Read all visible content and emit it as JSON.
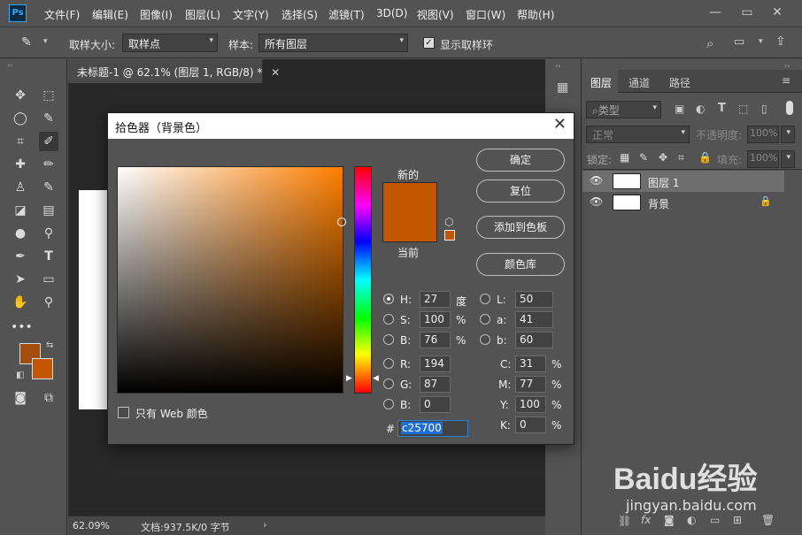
{
  "app": {
    "logo": "Ps"
  },
  "menu": [
    "文件(F)",
    "编辑(E)",
    "图像(I)",
    "图层(L)",
    "文字(Y)",
    "选择(S)",
    "滤镜(T)",
    "3D(D)",
    "视图(V)",
    "窗口(W)",
    "帮助(H)"
  ],
  "options": {
    "sample_size_label": "取样大小:",
    "sample_size_value": "取样点",
    "sample_label": "样本:",
    "sample_value": "所有图层",
    "show_ring_label": "显示取样环",
    "show_ring_checked": true
  },
  "document": {
    "tab_title": "未标题-1 @ 62.1% (图层 1, RGB/8) *",
    "zoom": "62.09%",
    "doc_info": "文档:937.5K/0 字节"
  },
  "colors": {
    "foreground": "#a44c0b",
    "background": "#c25700",
    "accent": "#31a8ff"
  },
  "layers_panel": {
    "tabs": [
      "图层",
      "通道",
      "路径"
    ],
    "filter_placeholder": "类型",
    "blend_mode": "正常",
    "opacity_label": "不透明度:",
    "opacity_value": "100%",
    "lock_label": "锁定:",
    "fill_label": "填充:",
    "fill_value": "100%",
    "layers": [
      {
        "name": "图层 1",
        "selected": true
      },
      {
        "name": "背景",
        "locked": true
      }
    ]
  },
  "picker": {
    "title": "拾色器（背景色）",
    "new_label": "新的",
    "current_label": "当前",
    "buttons": {
      "ok": "确定",
      "reset": "复位",
      "add_swatch": "添加到色板",
      "color_library": "颜色库"
    },
    "web_only_label": "只有 Web 颜色",
    "hsb": {
      "h_label": "H:",
      "h": "27",
      "h_unit": "度",
      "s_label": "S:",
      "s": "100",
      "s_unit": "%",
      "b_label": "B:",
      "b": "76",
      "b_unit": "%"
    },
    "rgb": {
      "r_label": "R:",
      "r": "194",
      "g_label": "G:",
      "g": "87",
      "b_label": "B:",
      "b": "0"
    },
    "lab": {
      "l_label": "L:",
      "l": "50",
      "a_label": "a:",
      "a": "41",
      "b_label": "b:",
      "b": "60"
    },
    "cmyk": {
      "c_label": "C:",
      "c": "31",
      "m_label": "M:",
      "m": "77",
      "y_label": "Y:",
      "y": "100",
      "k_label": "K:",
      "k": "0",
      "unit": "%"
    },
    "hex_label": "#",
    "hex": "c25700",
    "selected_color": "#c25700"
  },
  "watermark": {
    "brand": "Baidu经验",
    "url": "jingyan.baidu.com"
  }
}
